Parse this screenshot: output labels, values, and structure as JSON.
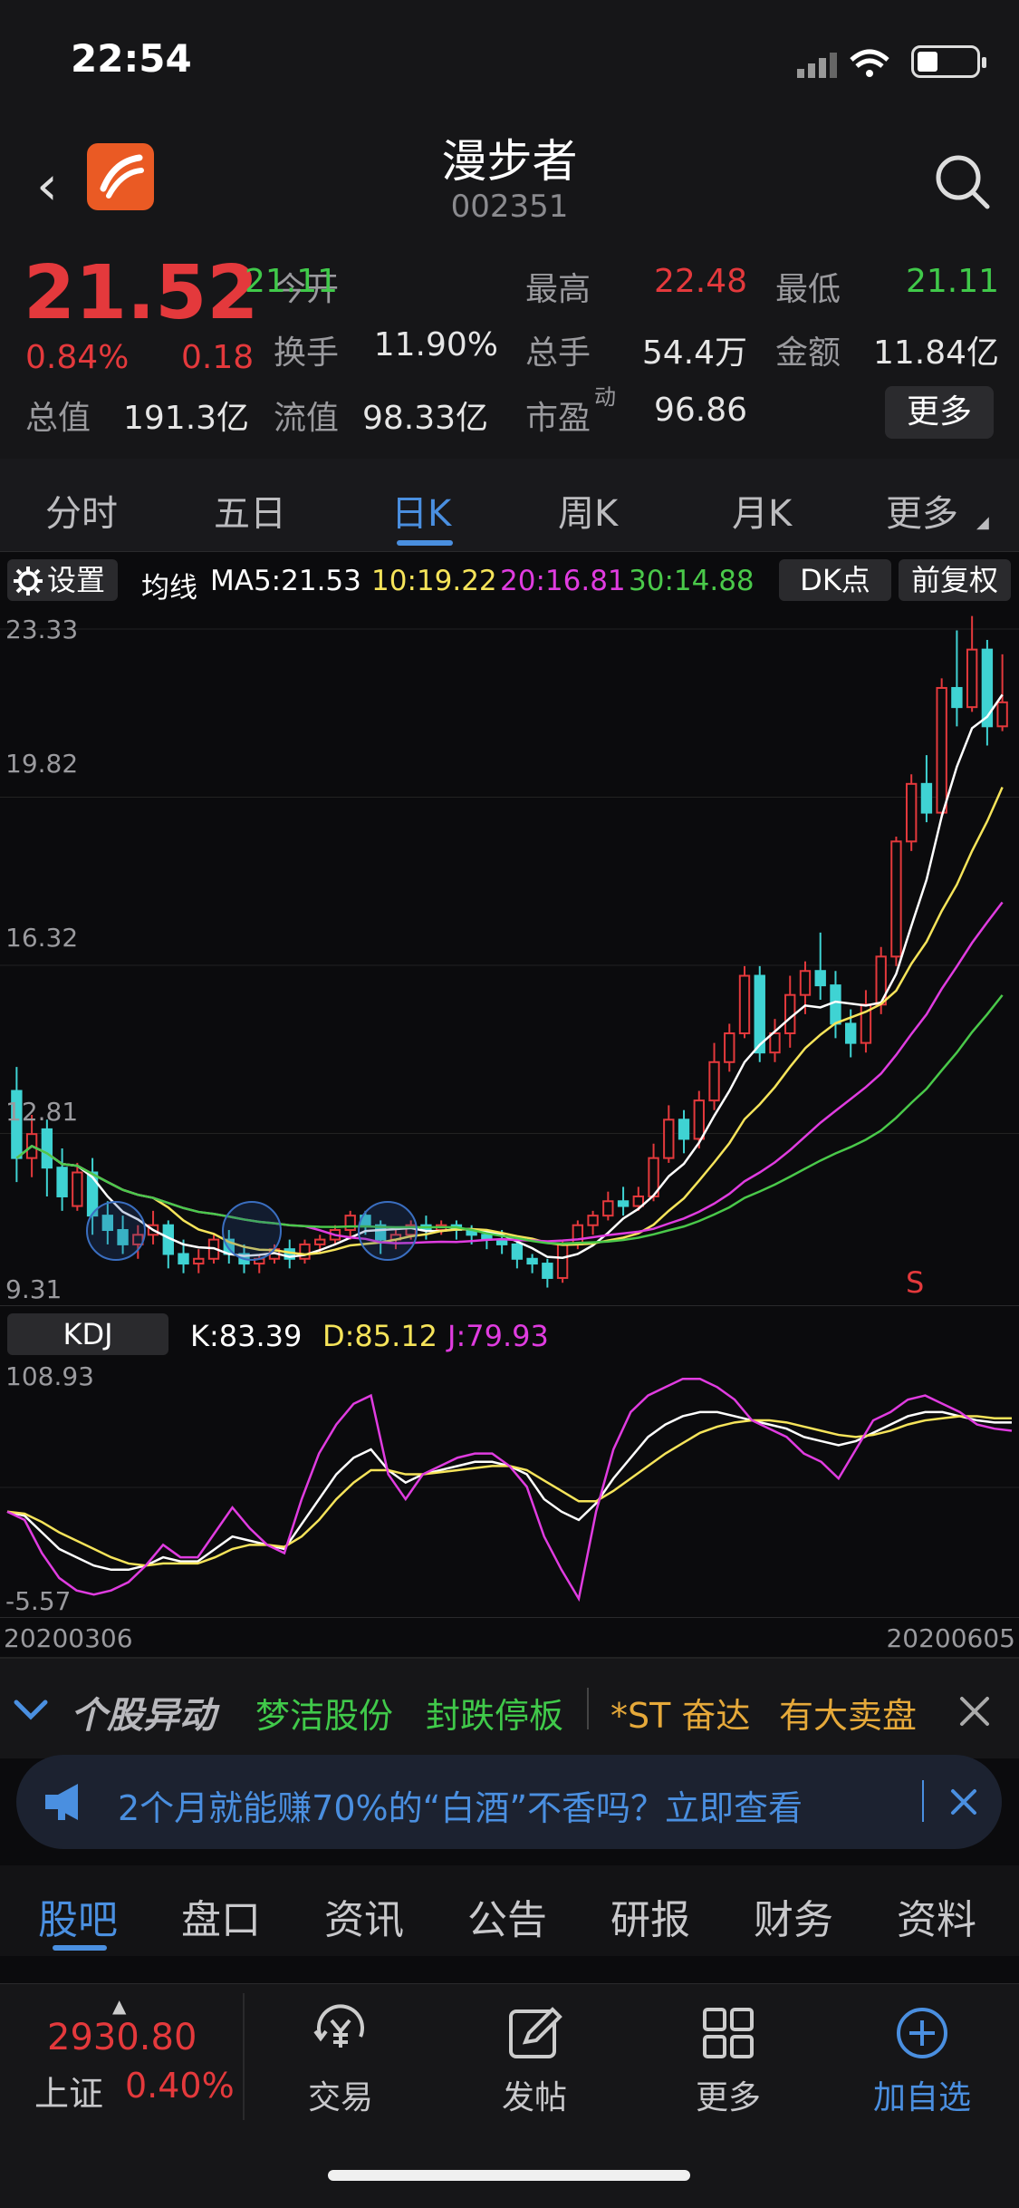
{
  "status": {
    "time": "22:54"
  },
  "header": {
    "name": "漫步者",
    "code": "002351"
  },
  "quote": {
    "price": "21.52",
    "change_pct": "0.84%",
    "change": "0.18",
    "fields": [
      {
        "label": "今开",
        "value": "21.11",
        "color": "green"
      },
      {
        "label": "最高",
        "value": "22.48",
        "color": "red"
      },
      {
        "label": "最低",
        "value": "21.11",
        "color": "green"
      },
      {
        "label": "换手",
        "value": "11.90%",
        "color": ""
      },
      {
        "label": "总手",
        "value": "54.4万",
        "color": ""
      },
      {
        "label": "金额",
        "value": "11.84亿",
        "color": ""
      },
      {
        "label": "总值",
        "value": "191.3亿",
        "color": ""
      },
      {
        "label": "流值",
        "value": "98.33亿",
        "color": ""
      },
      {
        "label": "市盈",
        "label_sup": "动",
        "value": "96.86",
        "color": ""
      }
    ],
    "more_label": "更多"
  },
  "tabs": [
    "分时",
    "五日",
    "日K",
    "周K",
    "月K",
    "更多"
  ],
  "active_tab": "日K",
  "chart_settings": {
    "settings_label": "设置",
    "ma_prefix": "均线",
    "ma5": "MA5:21.53",
    "ma10": "10:19.22",
    "ma20": "20:16.81",
    "ma30": "30:14.88",
    "dk_label": "DK点",
    "adjust_label": "前复权",
    "colors": {
      "ma5": "#ffffff",
      "ma10": "#f6e45a",
      "ma20": "#e03ce0",
      "ma30": "#4ac94a",
      "up": "#e4393c",
      "down": "#3fd3d3"
    }
  },
  "chart_data": [
    {
      "type": "candlestick",
      "title": "",
      "ylim": [
        9.31,
        23.33
      ],
      "y_ticks": [
        "23.33",
        "19.82",
        "16.32",
        "12.81",
        "9.31"
      ],
      "x_range": [
        "20200306",
        "20200605"
      ],
      "signal_label": "S",
      "candles": [
        [
          13.4,
          12.0,
          13.9,
          11.5
        ],
        [
          12.0,
          12.5,
          12.9,
          11.6
        ],
        [
          12.6,
          11.8,
          12.8,
          11.2
        ],
        [
          11.8,
          11.2,
          12.2,
          10.9
        ],
        [
          11.0,
          11.7,
          11.9,
          10.9
        ],
        [
          11.7,
          10.8,
          12.0,
          10.4
        ],
        [
          10.8,
          10.5,
          11.1,
          10.2
        ],
        [
          10.5,
          10.2,
          10.8,
          10.0
        ],
        [
          10.2,
          10.4,
          10.6,
          9.9
        ],
        [
          10.4,
          10.6,
          10.9,
          10.2
        ],
        [
          10.6,
          10.0,
          10.7,
          9.7
        ],
        [
          10.0,
          9.8,
          10.3,
          9.6
        ],
        [
          9.8,
          9.9,
          10.1,
          9.6
        ],
        [
          9.9,
          10.3,
          10.4,
          9.8
        ],
        [
          10.3,
          10.0,
          10.5,
          9.8
        ],
        [
          10.0,
          9.8,
          10.2,
          9.6
        ],
        [
          9.8,
          9.9,
          10.0,
          9.6
        ],
        [
          9.9,
          10.1,
          10.2,
          9.8
        ],
        [
          10.1,
          9.9,
          10.3,
          9.7
        ],
        [
          9.9,
          10.2,
          10.3,
          9.8
        ],
        [
          10.2,
          10.3,
          10.4,
          10.0
        ],
        [
          10.3,
          10.5,
          10.6,
          10.2
        ],
        [
          10.5,
          10.8,
          10.9,
          10.3
        ],
        [
          10.8,
          10.6,
          10.9,
          10.4
        ],
        [
          10.6,
          10.3,
          10.7,
          10.0
        ],
        [
          10.3,
          10.4,
          10.5,
          10.1
        ],
        [
          10.4,
          10.6,
          10.7,
          10.3
        ],
        [
          10.6,
          10.5,
          10.8,
          10.3
        ],
        [
          10.5,
          10.6,
          10.7,
          10.4
        ],
        [
          10.6,
          10.5,
          10.7,
          10.3
        ],
        [
          10.5,
          10.4,
          10.6,
          10.2
        ],
        [
          10.4,
          10.3,
          10.5,
          10.1
        ],
        [
          10.3,
          10.2,
          10.5,
          10.0
        ],
        [
          10.2,
          9.9,
          10.3,
          9.7
        ],
        [
          9.9,
          9.8,
          10.0,
          9.6
        ],
        [
          9.8,
          9.5,
          9.9,
          9.3
        ],
        [
          9.5,
          10.2,
          10.3,
          9.4
        ],
        [
          10.2,
          10.6,
          10.7,
          10.1
        ],
        [
          10.6,
          10.8,
          10.9,
          10.4
        ],
        [
          10.8,
          11.1,
          11.3,
          10.7
        ],
        [
          11.1,
          11.0,
          11.4,
          10.8
        ],
        [
          11.0,
          11.2,
          11.4,
          10.9
        ],
        [
          11.2,
          12.0,
          12.3,
          11.1
        ],
        [
          12.0,
          12.8,
          13.1,
          11.9
        ],
        [
          12.8,
          12.4,
          13.0,
          12.1
        ],
        [
          12.4,
          13.2,
          13.4,
          12.2
        ],
        [
          13.2,
          14.0,
          14.4,
          13.0
        ],
        [
          14.0,
          14.6,
          14.8,
          13.8
        ],
        [
          14.6,
          15.8,
          16.0,
          14.5
        ],
        [
          15.8,
          14.2,
          16.0,
          14.0
        ],
        [
          14.2,
          14.6,
          14.9,
          14.0
        ],
        [
          14.6,
          15.4,
          15.8,
          14.3
        ],
        [
          15.4,
          15.9,
          16.1,
          15.0
        ],
        [
          15.9,
          15.6,
          16.7,
          15.3
        ],
        [
          15.6,
          14.8,
          15.9,
          14.5
        ],
        [
          14.8,
          14.4,
          15.1,
          14.1
        ],
        [
          14.4,
          15.2,
          15.5,
          14.2
        ],
        [
          15.2,
          16.2,
          16.4,
          15.0
        ],
        [
          16.2,
          18.6,
          18.7,
          16.0
        ],
        [
          18.6,
          19.8,
          20.0,
          18.4
        ],
        [
          19.8,
          19.2,
          20.4,
          19.0
        ],
        [
          19.2,
          21.8,
          22.0,
          19.1
        ],
        [
          21.8,
          21.4,
          23.0,
          21.0
        ],
        [
          21.4,
          22.6,
          23.3,
          21.3
        ],
        [
          22.6,
          21.0,
          22.8,
          20.6
        ],
        [
          21.0,
          21.5,
          22.5,
          20.9
        ]
      ]
    },
    {
      "type": "line",
      "title": "KDJ",
      "ylim": [
        -5.57,
        108.93
      ],
      "y_ticks": [
        "108.93",
        "-5.57"
      ],
      "x_range": [
        "20200306",
        "20200605"
      ],
      "current": {
        "K": "K:83.39",
        "D": "D:85.12",
        "J": "J:79.93"
      },
      "series": [
        {
          "name": "K",
          "color": "#ffffff",
          "values": [
            40,
            38,
            30,
            22,
            18,
            14,
            12,
            12,
            14,
            18,
            16,
            16,
            22,
            28,
            26,
            24,
            22,
            34,
            46,
            58,
            66,
            70,
            60,
            54,
            58,
            60,
            62,
            64,
            64,
            62,
            58,
            46,
            40,
            36,
            44,
            56,
            66,
            76,
            82,
            86,
            88,
            88,
            86,
            84,
            82,
            80,
            76,
            74,
            72,
            74,
            78,
            82,
            86,
            88,
            88,
            86,
            84,
            83,
            83
          ]
        },
        {
          "name": "D",
          "color": "#f6e45a",
          "values": [
            40,
            39,
            35,
            30,
            26,
            22,
            18,
            15,
            14,
            15,
            15,
            15,
            18,
            22,
            24,
            24,
            23,
            28,
            36,
            46,
            54,
            60,
            60,
            58,
            58,
            59,
            60,
            61,
            62,
            62,
            60,
            55,
            50,
            45,
            45,
            50,
            56,
            62,
            68,
            73,
            78,
            81,
            83,
            84,
            84,
            83,
            81,
            79,
            77,
            76,
            77,
            79,
            82,
            84,
            85,
            86,
            86,
            85,
            85
          ]
        },
        {
          "name": "J",
          "color": "#e03ce0",
          "values": [
            40,
            36,
            20,
            8,
            2,
            0,
            2,
            6,
            14,
            24,
            18,
            18,
            30,
            42,
            32,
            24,
            20,
            46,
            68,
            82,
            92,
            96,
            58,
            46,
            58,
            62,
            66,
            68,
            68,
            62,
            52,
            28,
            12,
            -2,
            40,
            70,
            88,
            96,
            100,
            104,
            104,
            100,
            94,
            84,
            80,
            76,
            68,
            64,
            56,
            70,
            84,
            88,
            94,
            96,
            92,
            88,
            82,
            80,
            79
          ]
        }
      ]
    }
  ],
  "alerts": {
    "title": "个股异动",
    "items": [
      {
        "text": "梦洁股份",
        "color": "#40c94a"
      },
      {
        "text": "封跌停板",
        "color": "#40c94a"
      },
      {
        "text": "*ST 奋达",
        "color": "#e6a93a"
      },
      {
        "text": "有大卖盘",
        "color": "#e6a93a"
      }
    ]
  },
  "ad": {
    "text": "2个月就能赚70%的“白酒”不香吗？立即查看"
  },
  "content_tabs": [
    "股吧",
    "盘口",
    "资讯",
    "公告",
    "研报",
    "财务",
    "资料"
  ],
  "active_content_tab": "股吧",
  "bottom": {
    "index_value": "2930.80",
    "index_name": "上证",
    "index_pct": "0.40%",
    "nav": [
      {
        "label": "交易",
        "icon": "yuan-trade-icon"
      },
      {
        "label": "发帖",
        "icon": "compose-icon"
      },
      {
        "label": "更多",
        "icon": "grid-icon"
      },
      {
        "label": "加自选",
        "icon": "add-circle-icon"
      }
    ]
  }
}
